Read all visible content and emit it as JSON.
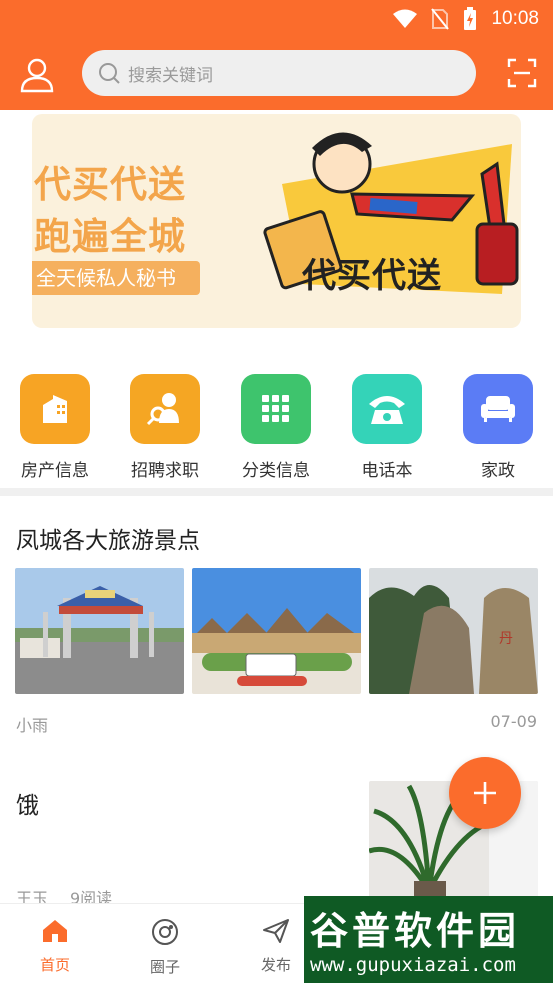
{
  "status_bar": {
    "time": "10:08"
  },
  "header": {
    "search_placeholder": "搜索关键词"
  },
  "banner": {
    "line1": "代买代送",
    "line2": "跑遍全城",
    "tagline": "全天候私人秘书",
    "graphic_text": "代买代送"
  },
  "categories": [
    {
      "label": "房产信息",
      "color": "#f7a424",
      "icon": "building-icon"
    },
    {
      "label": "招聘求职",
      "color": "#f5a623",
      "icon": "recruit-icon"
    },
    {
      "label": "分类信息",
      "color": "#3ec46d",
      "icon": "grid-icon"
    },
    {
      "label": "电话本",
      "color": "#34d3b8",
      "icon": "phone-icon"
    },
    {
      "label": "家政",
      "color": "#5b7cf5",
      "icon": "sofa-icon"
    }
  ],
  "posts": [
    {
      "title": "凤城各大旅游景点",
      "author": "小雨",
      "date": "07-09"
    },
    {
      "title": "饿",
      "author": "王玉",
      "reads": "9阅读"
    }
  ],
  "nav": [
    {
      "label": "首页",
      "icon": "home-icon",
      "active": true
    },
    {
      "label": "圈子",
      "icon": "circle-icon",
      "active": false
    },
    {
      "label": "发布",
      "icon": "send-icon",
      "active": false
    }
  ],
  "watermark": {
    "big": "谷普软件园",
    "small": "www.gupuxiazai.com"
  },
  "colors": {
    "accent": "#fb6c2c"
  }
}
